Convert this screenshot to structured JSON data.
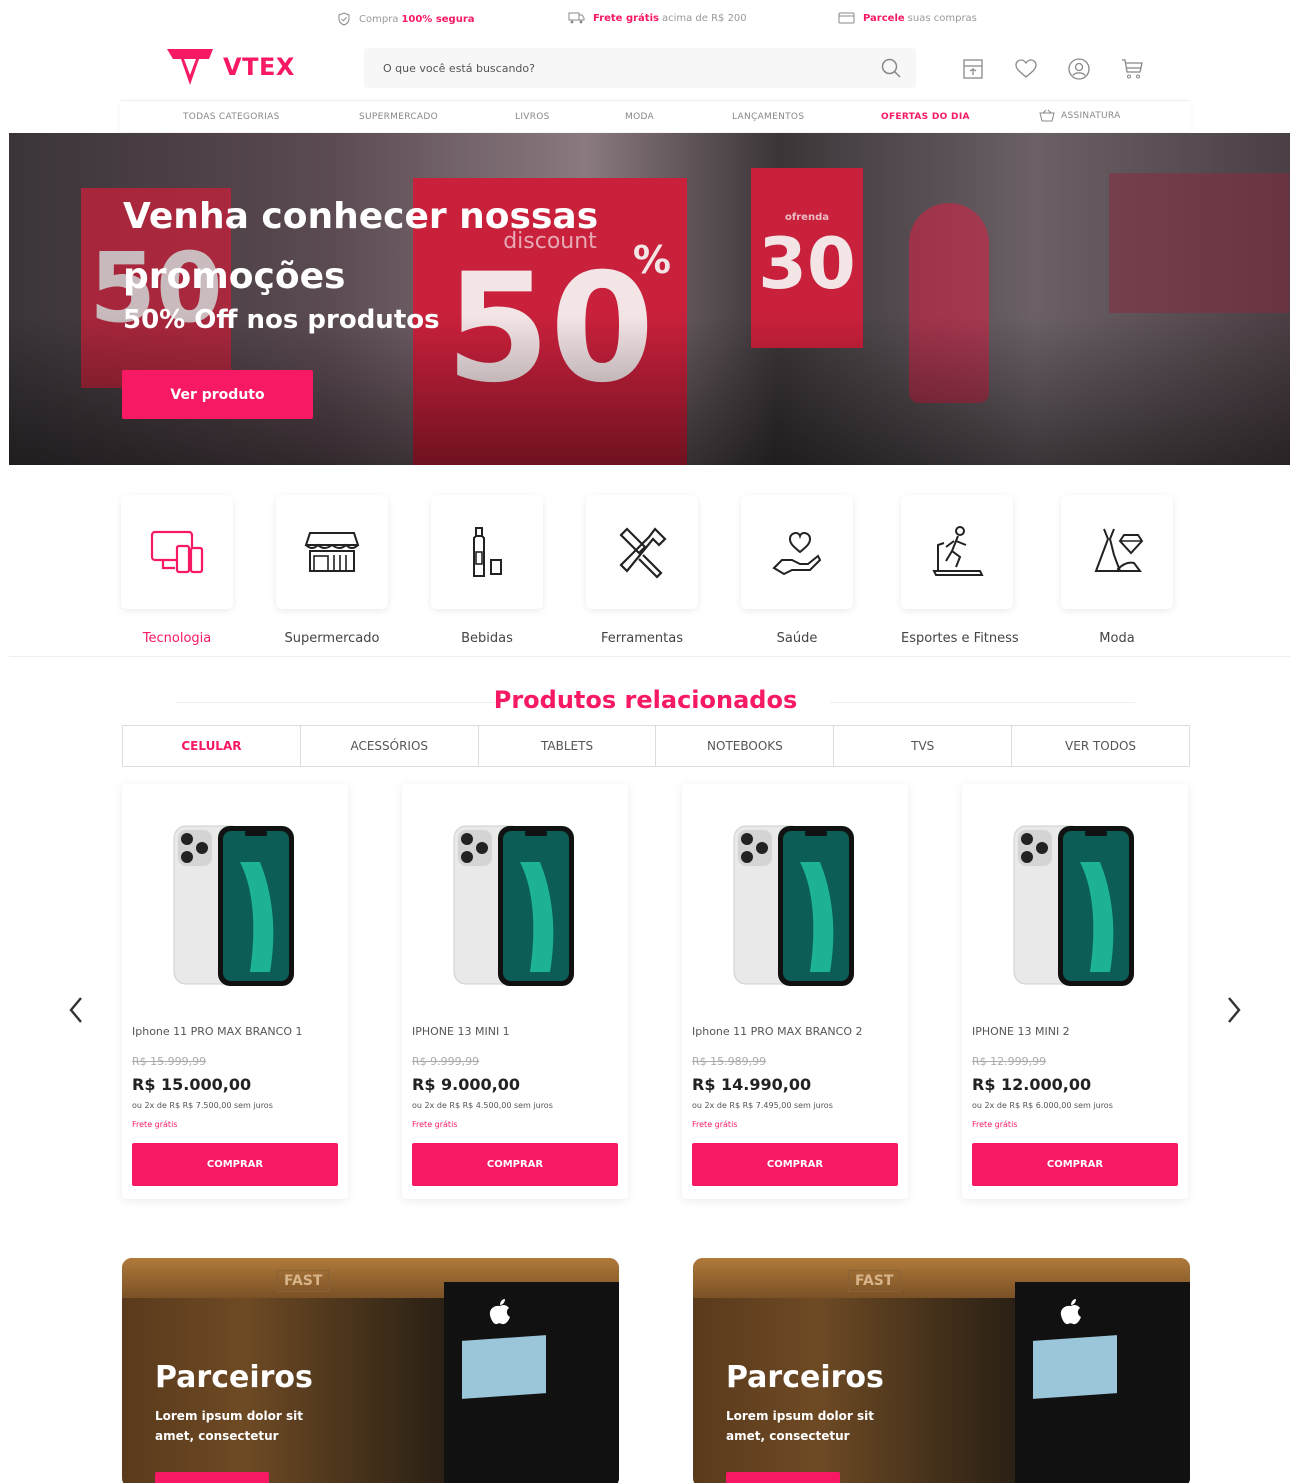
{
  "topbar": {
    "secure_prefix": "Compra",
    "secure_highlight": "100% segura",
    "shipping_highlight": "Frete grátis",
    "shipping_suffix": "acima de R$ 200",
    "installments_highlight": "Parcele",
    "installments_suffix": "suas compras"
  },
  "header": {
    "logo_text": "VTEX",
    "search_placeholder": "O que você está buscando?",
    "icons": [
      "store-icon",
      "heart-icon",
      "user-icon",
      "cart-icon"
    ]
  },
  "nav": {
    "items": [
      "TODAS CATEGORIAS",
      "SUPERMERCADO",
      "LIVROS",
      "MODA",
      "LANÇAMENTOS",
      "OFERTAS DO DIA",
      "ASSINATURA"
    ]
  },
  "hero": {
    "title": "Venha conhecer nossas promoções",
    "subtitle": "50% Off nos produtos",
    "button": "Ver produto",
    "sign_left": "50",
    "sign_discount": "discount",
    "sign_big": "50",
    "sign_percent": "%",
    "sign_right_top": "ofrenda",
    "sign_right": "30"
  },
  "categories": [
    {
      "label": "Tecnologia",
      "icon": "devices-icon",
      "active": true
    },
    {
      "label": "Supermercado",
      "icon": "store-front-icon",
      "active": false
    },
    {
      "label": "Bebidas",
      "icon": "bottle-icon",
      "active": false
    },
    {
      "label": "Ferramentas",
      "icon": "tools-icon",
      "active": false
    },
    {
      "label": "Saúde",
      "icon": "heart-hand-icon",
      "active": false
    },
    {
      "label": "Esportes e Fitness",
      "icon": "treadmill-icon",
      "active": false
    },
    {
      "label": "Moda",
      "icon": "dress-icon",
      "active": false
    }
  ],
  "related": {
    "title": "Produtos relacionados",
    "tabs": [
      "CELULAR",
      "ACESSÓRIOS",
      "TABLETS",
      "NOTEBOOKS",
      "TVS",
      "VER TODOS"
    ],
    "active_tab": "CELULAR"
  },
  "products": [
    {
      "name": "Iphone 11 PRO MAX BRANCO 1",
      "old_price": "R$ 15.999,99",
      "price": "R$ 15.000,00",
      "installments": "ou 2x de R$ R$ 7.500,00 sem juros",
      "shipping": "Frete grátis",
      "button": "COMPRAR"
    },
    {
      "name": "IPHONE 13 MINI 1",
      "old_price": "R$ 9.999,99",
      "price": "R$ 9.000,00",
      "installments": "ou 2x de R$ R$ 4.500,00 sem juros",
      "shipping": "Frete grátis",
      "button": "COMPRAR"
    },
    {
      "name": "Iphone 11 PRO MAX BRANCO 2",
      "old_price": "R$ 15.989,99",
      "price": "R$ 14.990,00",
      "installments": "ou 2x de R$ R$ 7.495,00 sem juros",
      "shipping": "Frete grátis",
      "button": "COMPRAR"
    },
    {
      "name": "IPHONE 13 MINI 2",
      "old_price": "R$ 12.999,99",
      "price": "R$ 12.000,00",
      "installments": "ou 2x de R$ R$ 6.000,00 sem juros",
      "shipping": "Frete grátis",
      "button": "COMPRAR"
    }
  ],
  "partners": [
    {
      "title": "Parceiros",
      "text": "Lorem ipsum dolor sit amet, consectetur",
      "sign": "FAST"
    },
    {
      "title": "Parceiros",
      "text": "Lorem ipsum dolor sit amet, consectetur",
      "sign": "FAST"
    }
  ],
  "colors": {
    "accent": "#f71963"
  }
}
